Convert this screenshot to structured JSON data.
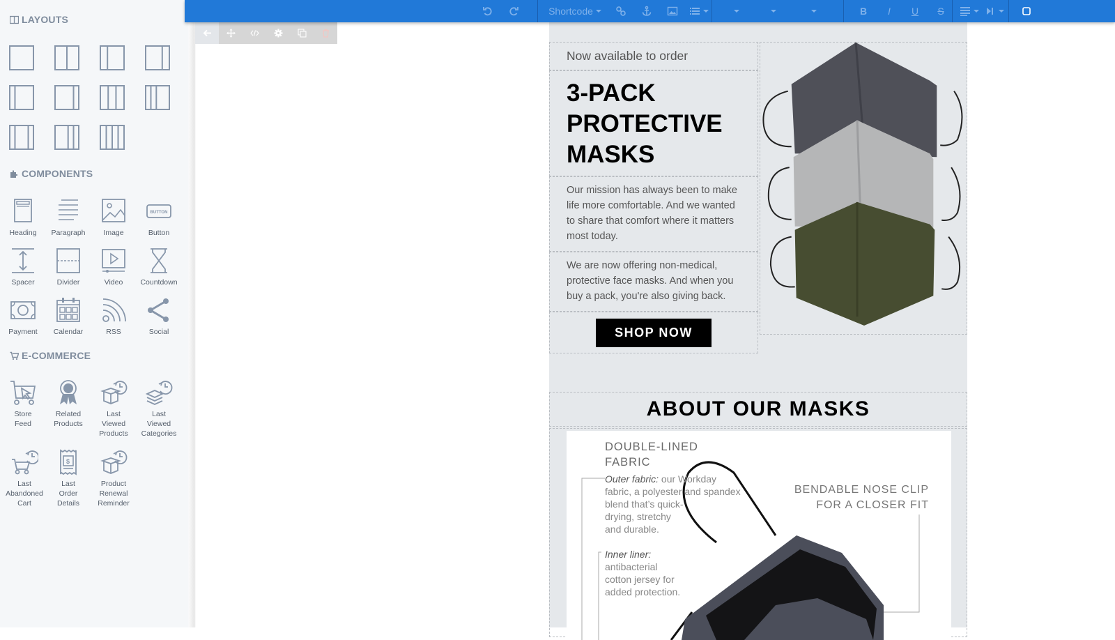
{
  "sidebar": {
    "layouts_title": "LAYOUTS",
    "components_title": "COMPONENTS",
    "ecommerce_title": "E-COMMERCE",
    "layouts": [
      {
        "name": "layout-1-column"
      },
      {
        "name": "layout-2-columns-equal"
      },
      {
        "name": "layout-2-columns-narrow-left"
      },
      {
        "name": "layout-2-columns-narrow-right"
      },
      {
        "name": "layout-2-columns-thin-left"
      },
      {
        "name": "layout-2-columns-thin-right"
      },
      {
        "name": "layout-3-columns-equal"
      },
      {
        "name": "layout-3-columns-wide-right"
      },
      {
        "name": "layout-3-columns-wide-center"
      },
      {
        "name": "layout-3-columns-wide-left"
      },
      {
        "name": "layout-4-columns"
      }
    ],
    "components": [
      {
        "label": "Heading",
        "icon": "heading-icon"
      },
      {
        "label": "Paragraph",
        "icon": "paragraph-icon"
      },
      {
        "label": "Image",
        "icon": "image-icon"
      },
      {
        "label": "Button",
        "icon": "button-icon"
      },
      {
        "label": "Spacer",
        "icon": "spacer-icon"
      },
      {
        "label": "Divider",
        "icon": "divider-icon"
      },
      {
        "label": "Video",
        "icon": "video-icon"
      },
      {
        "label": "Countdown",
        "icon": "hourglass-icon"
      },
      {
        "label": "Payment",
        "icon": "banknote-icon"
      },
      {
        "label": "Calendar",
        "icon": "calendar-icon"
      },
      {
        "label": "RSS",
        "icon": "rss-icon"
      },
      {
        "label": "Social",
        "icon": "share-icon"
      }
    ],
    "ecommerce": [
      {
        "label": "Store Feed",
        "icon": "cart-cursor-icon"
      },
      {
        "label": "Related Products",
        "icon": "award-thumbs-up-icon"
      },
      {
        "label": "Last Viewed Products",
        "icon": "box-history-icon"
      },
      {
        "label": "Last Viewed Categories",
        "icon": "layers-history-icon"
      },
      {
        "label": "Last Abandoned Cart",
        "icon": "cart-history-icon"
      },
      {
        "label": "Last Order Details",
        "icon": "receipt-icon"
      },
      {
        "label": "Product Renewal Reminder",
        "icon": "box-history-icon"
      }
    ],
    "button_icon_text": "BUTTON"
  },
  "toolbar": {
    "undo": "undo-icon",
    "redo": "redo-icon",
    "shortcode_label": "Shortcode",
    "bold": "B",
    "italic": "I",
    "underline": "U",
    "strike": "S"
  },
  "block_toolbar": {
    "buttons": [
      "back-arrow-icon",
      "move-icon",
      "code-icon",
      "settings-icon",
      "duplicate-icon",
      "delete-icon"
    ]
  },
  "email": {
    "pretitle": "Now available to order",
    "headline_lines": [
      "3-PACK",
      "PROTECTIVE",
      "MASKS"
    ],
    "paragraph1": "Our mission has always been to make life more comfortable. And we wanted to share that comfort where it matters most today.",
    "paragraph2": "We are now offering non-medical, protective face masks. And when you buy a pack, you're also giving back.",
    "cta_label": "SHOP NOW",
    "hero_image_alt": "Three stacked face masks in charcoal, light grey and olive",
    "about_heading": "ABOUT OUR MASKS",
    "info": {
      "title_lines": [
        "DOUBLE-LINED",
        "FABRIC"
      ],
      "outer_label": "Outer fabric:",
      "outer_text_lines": [
        " our Workday",
        "fabric, a polyester and spandex",
        "blend that’s quick-",
        "drying, stretchy",
        "and durable."
      ],
      "inner_label": "Inner liner:",
      "inner_text_lines": [
        "antibacterial",
        "cotton jersey for",
        "added protection."
      ],
      "nose_clip_lines": [
        "BENDABLE NOSE CLIP",
        "FOR A CLOSER FIT"
      ]
    }
  },
  "colors": {
    "toolbar_bg": "#2179d8",
    "sidebar_bg": "#f5f7f9",
    "email_bg": "#e5e8eb",
    "cta_bg": "#000000"
  }
}
